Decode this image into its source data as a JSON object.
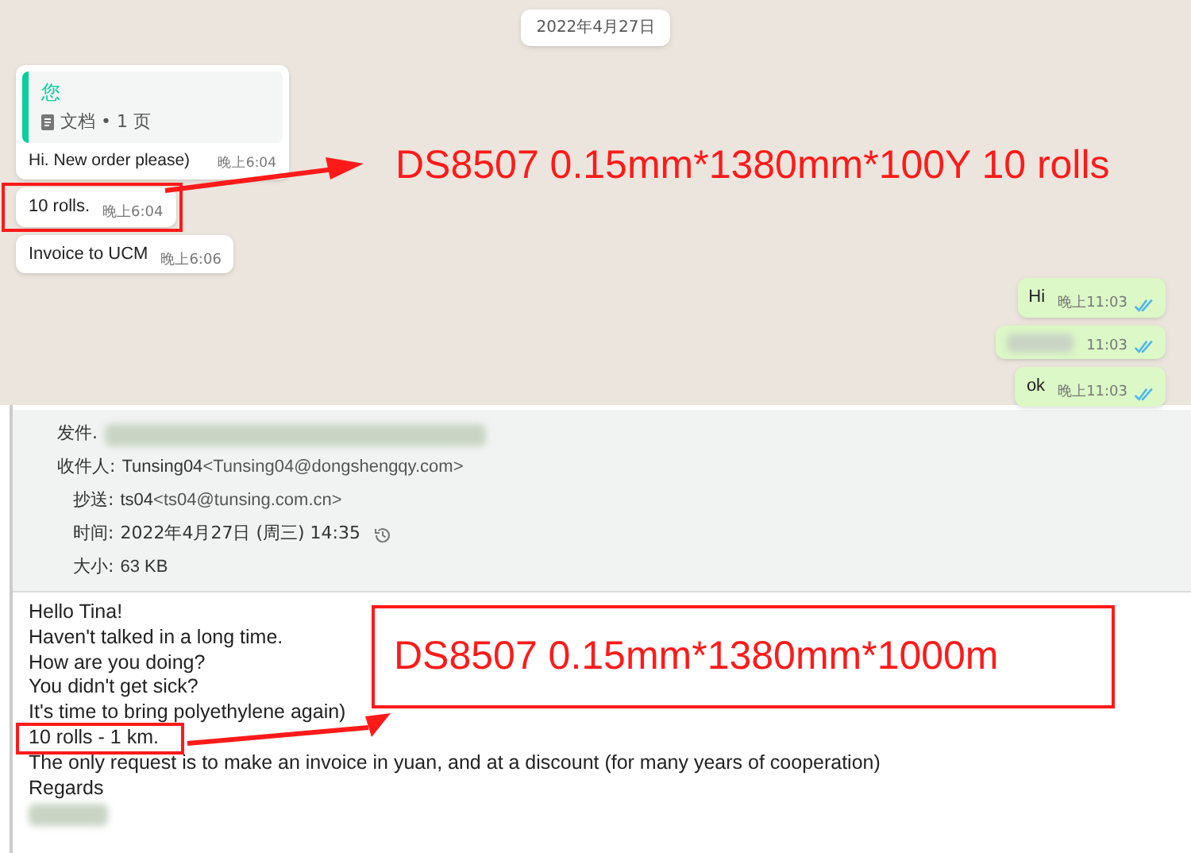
{
  "chat": {
    "date": "2022年4月27日",
    "incoming": [
      {
        "kind": "reply",
        "quote_author": "您",
        "quote_doc": "文档 • 1 页",
        "text": "Hi. New order please)",
        "time": "晚上6:04"
      },
      {
        "kind": "text",
        "text": "10 rolls.",
        "time": "晚上6:04",
        "highlighted": true
      },
      {
        "kind": "text",
        "text": "Invoice to UCM",
        "time": "晚上6:06"
      }
    ],
    "outgoing": [
      {
        "kind": "text",
        "text": "Hi",
        "time": "晚上11:03",
        "read": true
      },
      {
        "kind": "redacted",
        "time": "11:03",
        "read": true
      },
      {
        "kind": "text",
        "text": "ok",
        "time": "晚上11:03",
        "read": true
      }
    ]
  },
  "email": {
    "header": [
      {
        "kind": "redacted",
        "label": "发件."
      },
      {
        "kind": "address",
        "label": "收件人:",
        "name": "Tunsing04",
        "address": "<Tunsing04@dongshengqy.com>"
      },
      {
        "kind": "address",
        "label": "抄送:",
        "name": "ts04",
        "address": "<ts04@tunsing.com.cn>"
      },
      {
        "kind": "time",
        "label": "时间:",
        "value": "2022年4月27日 (周三) 14:35"
      },
      {
        "kind": "plain",
        "label": "大小:",
        "value": "63 KB"
      }
    ],
    "body": [
      {
        "text": "Hello Tina!",
        "highlighted": false
      },
      {
        "text": "Haven't talked in a long time.",
        "highlighted": false
      },
      {
        "text": "How are you doing?",
        "highlighted": false
      },
      {
        "text": "You didn't get sick?",
        "highlighted": false
      },
      {
        "text": "It's time to bring polyethylene again)",
        "highlighted": false
      },
      {
        "text": "10 rolls - 1 km.",
        "highlighted": true
      },
      {
        "text": "The only request is to make an invoice in yuan, and at a discount (for many years of cooperation)",
        "highlighted": false
      },
      {
        "text": "Regards",
        "highlighted": false
      }
    ]
  },
  "annotations": [
    {
      "kind": "plain",
      "text": "DS8507 0.15mm*1380mm*100Y 10 rolls"
    },
    {
      "kind": "boxed",
      "text": "DS8507 0.15mm*1380mm*1000m"
    }
  ]
}
